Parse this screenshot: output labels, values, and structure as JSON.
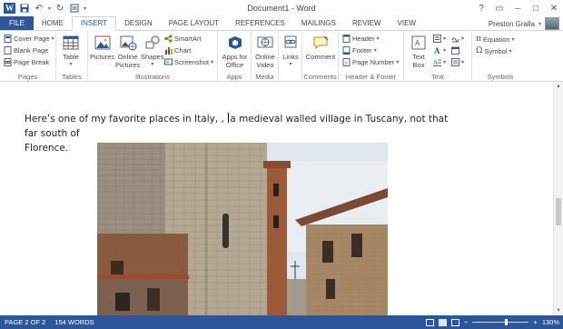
{
  "window": {
    "title": "Document1 - Word",
    "app_icon_letter": "W",
    "controls": [
      "?",
      "▭",
      "–",
      "□",
      "✕"
    ]
  },
  "tabs": [
    {
      "label": "FILE"
    },
    {
      "label": "HOME"
    },
    {
      "label": "INSERT"
    },
    {
      "label": "DESIGN"
    },
    {
      "label": "PAGE LAYOUT"
    },
    {
      "label": "REFERENCES"
    },
    {
      "label": "MAILINGS"
    },
    {
      "label": "REVIEW"
    },
    {
      "label": "VIEW"
    }
  ],
  "user": {
    "name": "Preston Gralla"
  },
  "ribbon": {
    "pages": {
      "label": "Pages",
      "cover_page": "Cover Page",
      "blank_page": "Blank Page",
      "page_break": "Page Break"
    },
    "tables": {
      "label": "Tables",
      "table": "Table"
    },
    "illustrations": {
      "label": "Illustrations",
      "pictures": "Pictures",
      "online_pictures_1": "Online",
      "online_pictures_2": "Pictures",
      "shapes": "Shapes",
      "smartart": "SmartArt",
      "chart": "Chart",
      "screenshot": "Screenshot"
    },
    "apps": {
      "label": "Apps",
      "apps_for_office_1": "Apps for",
      "apps_for_office_2": "Office"
    },
    "media": {
      "label": "Media",
      "online_video_1": "Online",
      "online_video_2": "Video"
    },
    "links": {
      "label": "",
      "links": "Links"
    },
    "comments": {
      "label": "Comments",
      "comment": "Comment"
    },
    "header_footer": {
      "label": "Header & Footer",
      "header": "Header",
      "footer": "Footer",
      "page_number": "Page Number"
    },
    "text": {
      "label": "Text",
      "text_box_1": "Text",
      "text_box_2": "Box"
    },
    "symbols": {
      "label": "Symbols",
      "equation": "Equation",
      "symbol": "Symbol"
    }
  },
  "document": {
    "text_before_cursor": "Here’s one of my favorite places in Italy, ,",
    "text_after_cursor": "a medieval walled village in Tuscany, not that far south of",
    "text_line2": "Florence."
  },
  "status": {
    "page": "PAGE 2 OF 2",
    "words": "154 WORDS",
    "zoom": "130%"
  },
  "colors": {
    "accent": "#2b579a",
    "ribbon_border": "#d4d4d4"
  }
}
